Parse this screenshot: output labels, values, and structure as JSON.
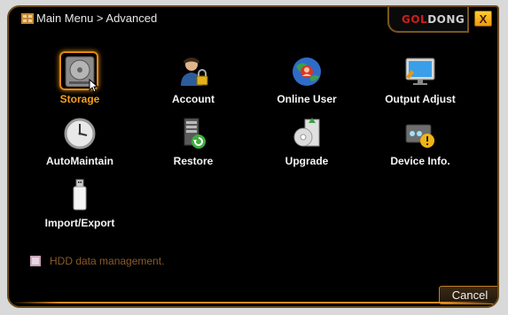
{
  "window": {
    "title": "Main Menu > Advanced",
    "brand_red": "GOL",
    "brand_rest": "DONG",
    "close_label": "X"
  },
  "menu": {
    "items": [
      {
        "label": "Storage",
        "icon": "hdd-icon",
        "selected": true
      },
      {
        "label": "Account",
        "icon": "user-lock-icon"
      },
      {
        "label": "Online User",
        "icon": "online-user-icon"
      },
      {
        "label": "Output Adjust",
        "icon": "monitor-icon"
      },
      {
        "label": "AutoMaintain",
        "icon": "clock-icon"
      },
      {
        "label": "Restore",
        "icon": "restore-icon"
      },
      {
        "label": "Upgrade",
        "icon": "upgrade-disc-icon"
      },
      {
        "label": "Device Info.",
        "icon": "device-info-icon"
      },
      {
        "label": "Import/Export",
        "icon": "usb-drive-icon"
      }
    ]
  },
  "hint": {
    "text": "HDD data management."
  },
  "footer": {
    "cancel_label": "Cancel"
  },
  "colors": {
    "accent": "#e08a12",
    "selected_label": "#f5a01c",
    "brand_red": "#d31b1b",
    "hint_text": "#8a5a2a",
    "frame_border": "#6b4a1a"
  }
}
